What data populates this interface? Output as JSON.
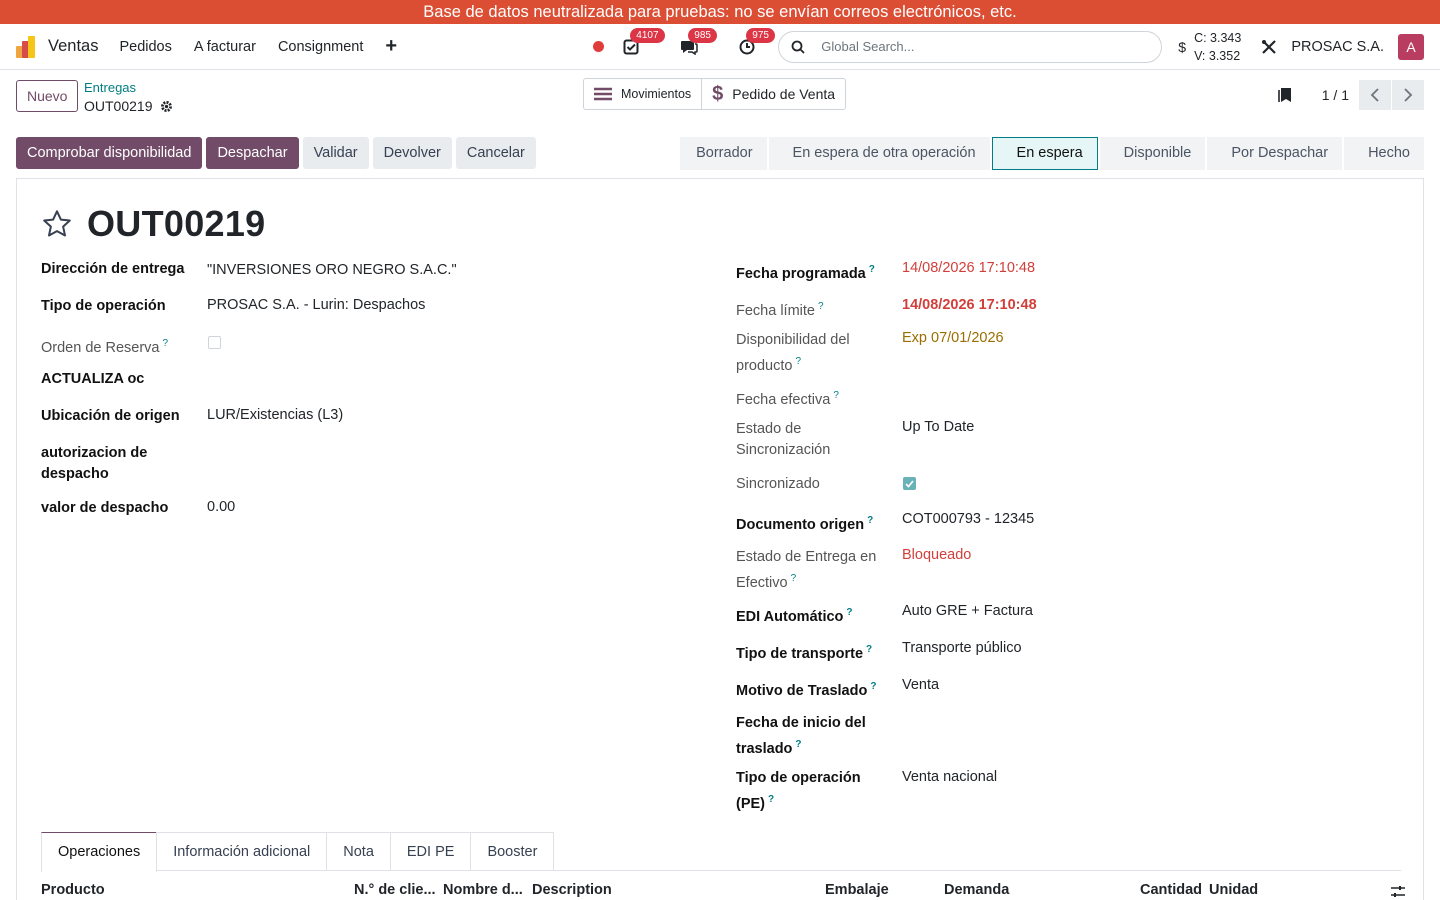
{
  "banner": "Base de datos neutralizada para pruebas: no se envían correos electrónicos, etc.",
  "navbar": {
    "app_name": "Ventas",
    "menu": [
      "Pedidos",
      "A facturar",
      "Consignment"
    ],
    "badges": {
      "activities": "4107",
      "messages": "985",
      "clock": "975"
    },
    "search_placeholder": "Global Search...",
    "rates": {
      "buy": "C: 3.343",
      "sell": "V: 3.352"
    },
    "company": "PROSAC S.A.",
    "avatar": "A"
  },
  "control": {
    "new_label": "Nuevo",
    "breadcrumb": "Entregas",
    "record": "OUT00219",
    "smart_moves": "Movimientos",
    "smart_sale": "Pedido de Venta",
    "pager": "1 / 1"
  },
  "actions": [
    "Comprobar disponibilidad",
    "Despachar",
    "Validar",
    "Devolver",
    "Cancelar"
  ],
  "stages": [
    "Borrador",
    "En espera de otra operación",
    "En espera",
    "Disponible",
    "Por Despachar",
    "Hecho"
  ],
  "active_stage": "En espera",
  "title": "OUT00219",
  "left_fields": {
    "direccion": {
      "label": "Dirección de entrega",
      "value": "\"INVERSIONES ORO NEGRO S.A.C.\""
    },
    "tipo_op": {
      "label": "Tipo de operación",
      "value": "PROSAC S.A. - Lurin: Despachos"
    },
    "orden_reserva": {
      "label": "Orden de Reserva"
    },
    "actualiza": {
      "label": "ACTUALIZA oc"
    },
    "ubicacion": {
      "label": "Ubicación de origen",
      "value": "LUR/Existencias (L3)"
    },
    "autorizacion": {
      "label1": "autorizacion de",
      "label2": "despacho"
    },
    "valor": {
      "label": "valor de despacho",
      "value": "0.00"
    }
  },
  "right_fields": {
    "fecha_prog": {
      "label": "Fecha programada",
      "value": "14/08/2026 17:10:48"
    },
    "fecha_limite": {
      "label": "Fecha límite",
      "value": "14/08/2026 17:10:48"
    },
    "disponibilidad": {
      "label1": "Disponibilidad del",
      "label2": "producto",
      "value": "Exp 07/01/2026"
    },
    "fecha_efectiva": {
      "label": "Fecha efectiva"
    },
    "estado_sync": {
      "label1": "Estado de",
      "label2": "Sincronización",
      "value": "Up To Date"
    },
    "sincronizado": {
      "label": "Sincronizado"
    },
    "doc_origen": {
      "label": "Documento origen",
      "value": "COT000793 - 12345"
    },
    "estado_entrega": {
      "label1": "Estado de Entrega en",
      "label2": "Efectivo",
      "value": "Bloqueado"
    },
    "edi": {
      "label": "EDI Automático",
      "value": "Auto GRE + Factura"
    },
    "tipo_transporte": {
      "label": "Tipo de transporte",
      "value": "Transporte público"
    },
    "motivo": {
      "label": "Motivo de Traslado",
      "value": "Venta"
    },
    "fecha_inicio": {
      "label1": "Fecha de inicio del",
      "label2": "traslado"
    },
    "tipo_op_pe": {
      "label1": "Tipo de operación",
      "label2": "(PE)",
      "value": "Venta nacional"
    }
  },
  "tabs": [
    "Operaciones",
    "Información adicional",
    "Nota",
    "EDI PE",
    "Booster"
  ],
  "table_headers": [
    "Producto",
    "N.° de clie...",
    "Nombre d...",
    "Description",
    "Embalaje",
    "Demanda",
    "Cantidad",
    "Unidad"
  ],
  "colors": {
    "brand": "#714b67",
    "accent": "#017e84",
    "banner": "#dc4e34",
    "danger": "#d23f3a"
  }
}
